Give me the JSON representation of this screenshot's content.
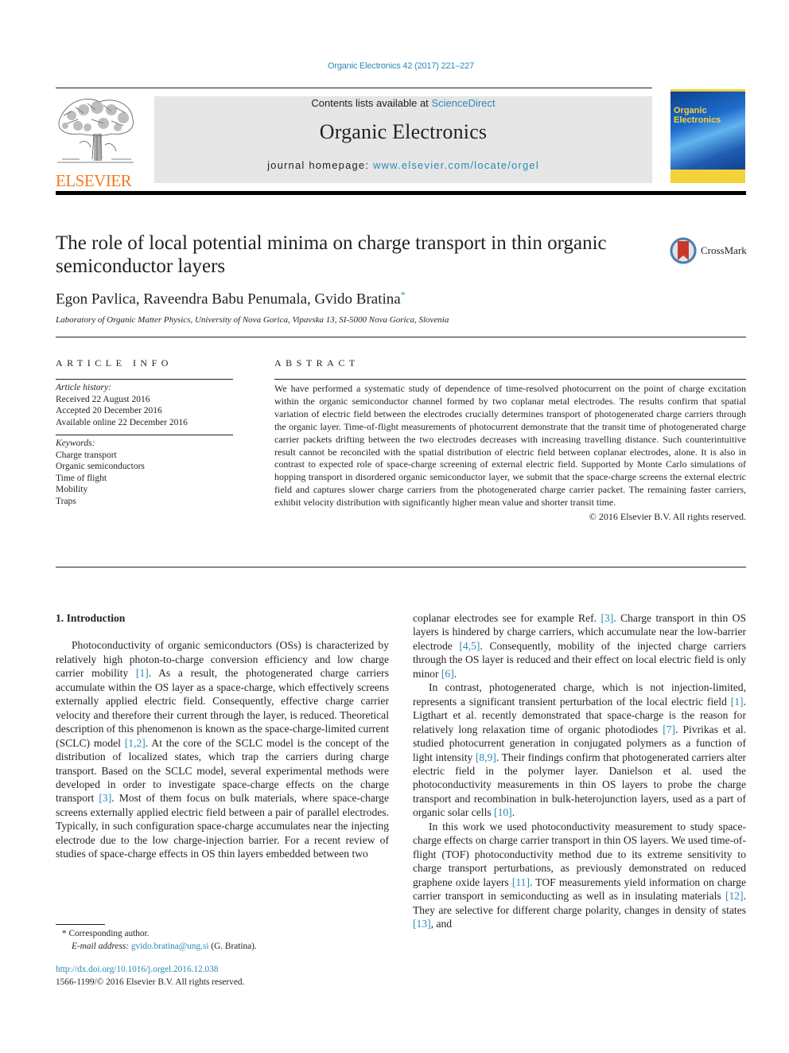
{
  "header": {
    "journal_reference": "Organic Electronics 42 (2017) 221–227",
    "contents_prefix": "Contents lists available at ",
    "contents_link": "ScienceDirect",
    "journal_name": "Organic Electronics",
    "homepage_prefix": "journal homepage: ",
    "homepage_link": "www.elsevier.com/locate/orgel",
    "publisher_logo_text": "ELSEVIER",
    "cover_title_line1": "Organic",
    "cover_title_line2": "Electronics",
    "colors": {
      "link": "#2a8ab6",
      "publisher_orange": "#f47a20",
      "masthead_gray": "#e6e6e6"
    }
  },
  "article": {
    "title": "The role of local potential minima on charge transport in thin organic semiconductor layers",
    "crossmark_label": "CrossMark",
    "authors": "Egon Pavlica, Raveendra Babu Penumala, Gvido Bratina",
    "author_mark": "*",
    "affiliation": "Laboratory of Organic Matter Physics, University of Nova Gorica, Vipavska 13, SI-5000 Nova Gorica, Slovenia"
  },
  "article_info": {
    "heading": "ARTICLE INFO",
    "history_label": "Article history:",
    "history": [
      "Received 22 August 2016",
      "Accepted 20 December 2016",
      "Available online 22 December 2016"
    ],
    "keywords_label": "Keywords:",
    "keywords": [
      "Charge transport",
      "Organic semiconductors",
      "Time of flight",
      "Mobility",
      "Traps"
    ]
  },
  "abstract": {
    "heading": "ABSTRACT",
    "text": "We have performed a systematic study of dependence of time-resolved photocurrent on the point of charge excitation within the organic semiconductor channel formed by two coplanar metal electrodes. The results confirm that spatial variation of electric field between the electrodes crucially determines transport of photogenerated charge carriers through the organic layer. Time-of-flight measurements of photocurrent demonstrate that the transit time of photogenerated charge carrier packets drifting between the two electrodes decreases with increasing travelling distance. Such counterintuitive result cannot be reconciled with the spatial distribution of electric field between coplanar electrodes, alone. It is also in contrast to expected role of space-charge screening of external electric field. Supported by Monte Carlo simulations of hopping transport in disordered organic semiconductor layer, we submit that the space-charge screens the external electric field and captures slower charge carriers from the photogenerated charge carrier packet. The remaining faster carriers, exhibit velocity distribution with significantly higher mean value and shorter transit time.",
    "copyright": "© 2016 Elsevier B.V. All rights reserved."
  },
  "body": {
    "section_heading": "1.  Introduction",
    "left_p1": [
      {
        "t": "Photoconductivity of organic semiconductors (OSs) is characterized by relatively high photon-to-charge conversion efficiency and low charge carrier mobility "
      },
      {
        "ref": "[1]"
      },
      {
        "t": ". As a result, the photogenerated charge carriers accumulate within the OS layer as a space-charge, which effectively screens externally applied electric field. Consequently, effective charge carrier velocity and therefore their current through the layer, is reduced. Theoretical description of this phenomenon is known as the space-charge-limited current (SCLC) model "
      },
      {
        "ref": "[1,2]"
      },
      {
        "t": ". At the core of the SCLC model is the concept of the distribution of localized states, which trap the carriers during charge transport. Based on the SCLC model, several experimental methods were developed in order to investigate space-charge effects on the charge transport "
      },
      {
        "ref": "[3]"
      },
      {
        "t": ". Most of them focus on bulk materials, where space-charge screens externally applied electric field between a pair of parallel electrodes. Typically, in such configuration space-charge accumulates near the injecting electrode due to the low charge-injection barrier. For a recent review of studies of space-charge effects in OS thin layers embedded between two"
      }
    ],
    "right_p1": [
      {
        "t": "coplanar electrodes see for example Ref. "
      },
      {
        "ref": "[3]"
      },
      {
        "t": ". Charge transport in thin OS layers is hindered by charge carriers, which accumulate near the low-barrier electrode "
      },
      {
        "ref": "[4,5]"
      },
      {
        "t": ". Consequently, mobility of the injected charge carriers through the OS layer is reduced and their effect on local electric field is only minor "
      },
      {
        "ref": "[6]"
      },
      {
        "t": "."
      }
    ],
    "right_p2": [
      {
        "t": "In contrast, photogenerated charge, which is not injection-limited, represents a significant transient perturbation of the local electric field "
      },
      {
        "ref": "[1]"
      },
      {
        "t": ". Ligthart et al. recently demonstrated that space-charge is the reason for relatively long relaxation time of organic photodiodes "
      },
      {
        "ref": "[7]"
      },
      {
        "t": ". Pivrikas et al. studied photocurrent generation in conjugated polymers as a function of light intensity "
      },
      {
        "ref": "[8,9]"
      },
      {
        "t": ". Their findings confirm that photogenerated carriers alter electric field in the polymer layer. Danielson et al. used the photoconductivity measurements in thin OS layers to probe the charge transport and recombination in bulk-heterojunction layers, used as a part of organic solar cells "
      },
      {
        "ref": "[10]"
      },
      {
        "t": "."
      }
    ],
    "right_p3": [
      {
        "t": "In this work we used photoconductivity measurement to study space-charge effects on charge carrier transport in thin OS layers. We used time-of-flight (TOF) photoconductivity method due to its extreme sensitivity to charge transport perturbations, as previously demonstrated on reduced graphene oxide layers "
      },
      {
        "ref": "[11]"
      },
      {
        "t": ". TOF measurements yield information on charge carrier transport in semiconducting as well as in insulating materials "
      },
      {
        "ref": "[12]"
      },
      {
        "t": ". They are selective for different charge polarity, changes in density of states "
      },
      {
        "ref": "[13]"
      },
      {
        "t": ", and"
      }
    ]
  },
  "footnote": {
    "marker": "*",
    "corresponding": "Corresponding author.",
    "email_label": "E-mail address:",
    "email": "gvido.bratina@ung.si",
    "email_suffix": " (G. Bratina)."
  },
  "footer": {
    "doi_link": "http://dx.doi.org/10.1016/j.orgel.2016.12.038",
    "issn_copyright": "1566-1199/© 2016 Elsevier B.V. All rights reserved."
  }
}
